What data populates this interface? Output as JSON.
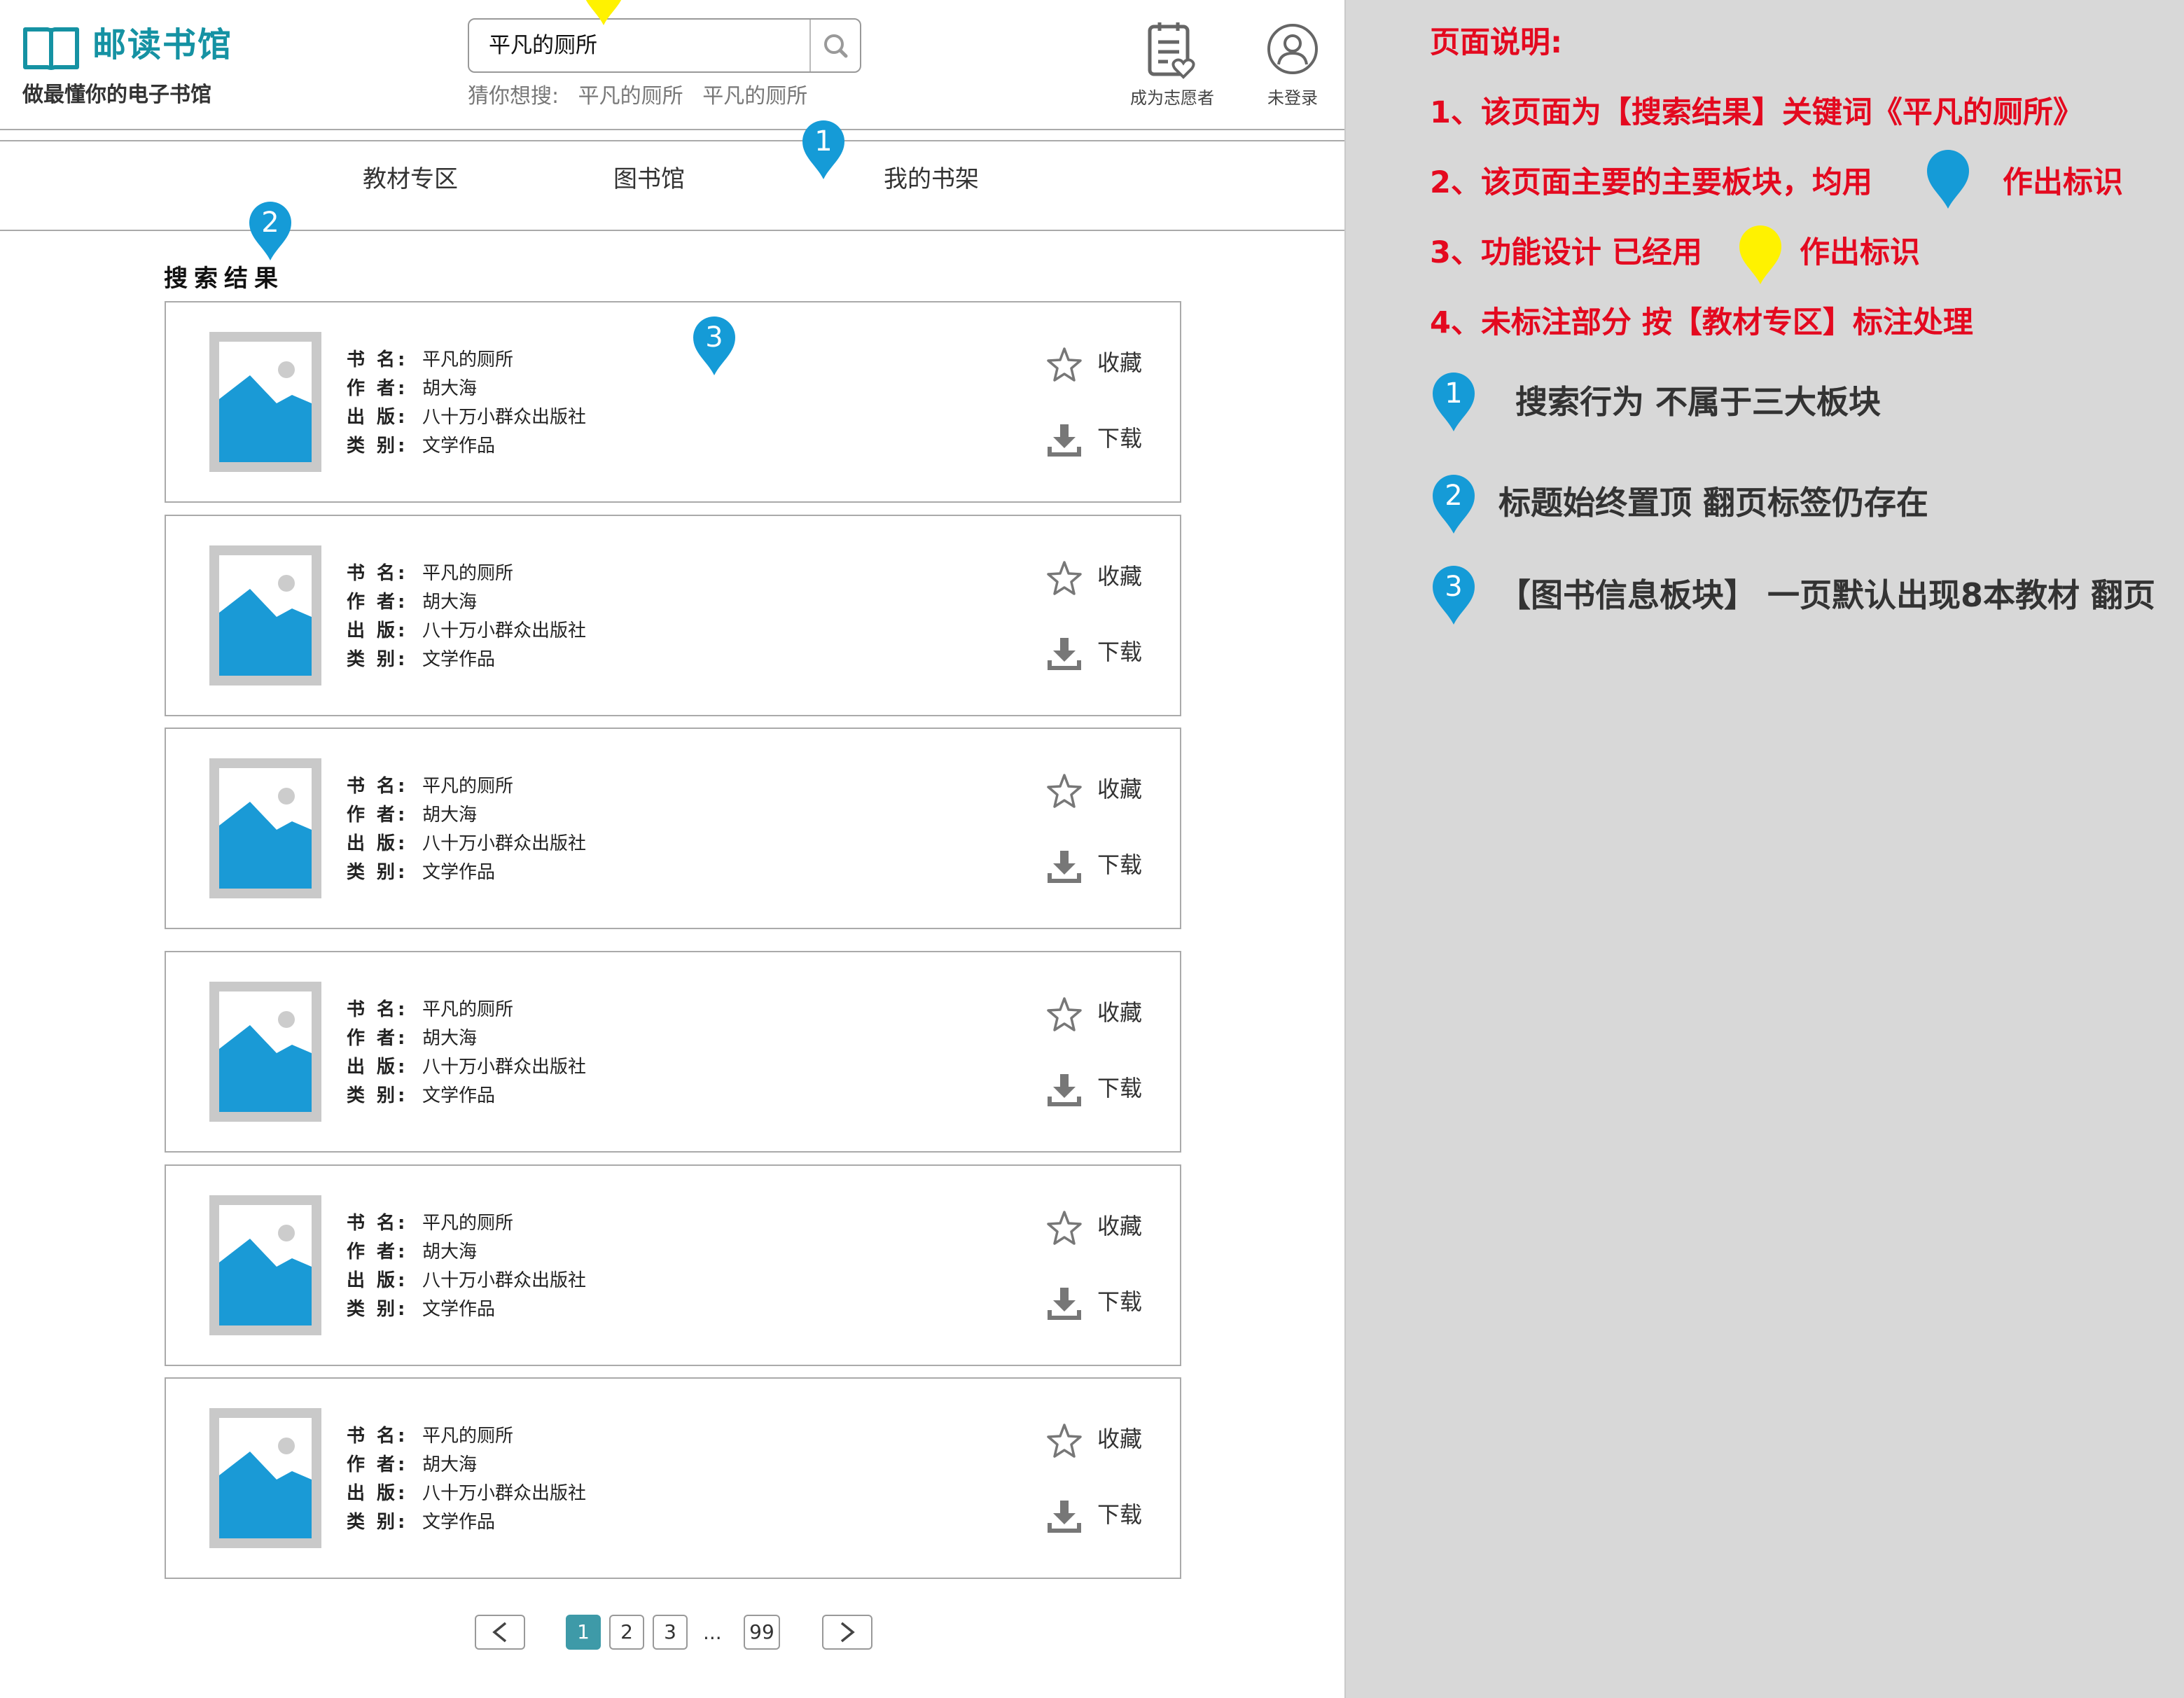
{
  "header": {
    "logo_text": "邮读书馆",
    "slogan": "做最懂你的电子书馆",
    "search_value": "平凡的厕所",
    "guess_label": "猜你想搜:",
    "guess_items": [
      "平凡的厕所",
      "平凡的厕所"
    ],
    "volunteer_label": "成为志愿者",
    "login_label": "未登录"
  },
  "nav": {
    "items": [
      {
        "label": "教材专区"
      },
      {
        "label": "图书馆"
      },
      {
        "label": "我的书架"
      }
    ]
  },
  "main": {
    "title": "搜索结果",
    "books": [
      {
        "name_key": "书 名:",
        "name": "平凡的厕所",
        "author_key": "作 者:",
        "author": "胡大海",
        "publisher_key": "出 版:",
        "publisher": "八十万小群众出版社",
        "category_key": "类 别:",
        "category": "文学作品",
        "fav_label": "收藏",
        "download_label": "下载"
      },
      {
        "name_key": "书 名:",
        "name": "平凡的厕所",
        "author_key": "作 者:",
        "author": "胡大海",
        "publisher_key": "出 版:",
        "publisher": "八十万小群众出版社",
        "category_key": "类 别:",
        "category": "文学作品",
        "fav_label": "收藏",
        "download_label": "下载"
      },
      {
        "name_key": "书 名:",
        "name": "平凡的厕所",
        "author_key": "作 者:",
        "author": "胡大海",
        "publisher_key": "出 版:",
        "publisher": "八十万小群众出版社",
        "category_key": "类 别:",
        "category": "文学作品",
        "fav_label": "收藏",
        "download_label": "下载"
      },
      {
        "name_key": "书 名:",
        "name": "平凡的厕所",
        "author_key": "作 者:",
        "author": "胡大海",
        "publisher_key": "出 版:",
        "publisher": "八十万小群众出版社",
        "category_key": "类 别:",
        "category": "文学作品",
        "fav_label": "收藏",
        "download_label": "下载"
      },
      {
        "name_key": "书 名:",
        "name": "平凡的厕所",
        "author_key": "作 者:",
        "author": "胡大海",
        "publisher_key": "出 版:",
        "publisher": "八十万小群众出版社",
        "category_key": "类 别:",
        "category": "文学作品",
        "fav_label": "收藏",
        "download_label": "下载"
      },
      {
        "name_key": "书 名:",
        "name": "平凡的厕所",
        "author_key": "作 者:",
        "author": "胡大海",
        "publisher_key": "出 版:",
        "publisher": "八十万小群众出版社",
        "category_key": "类 别:",
        "category": "文学作品",
        "fav_label": "收藏",
        "download_label": "下载"
      }
    ]
  },
  "pagination": {
    "prev_icon": "chevron-left-icon",
    "next_icon": "chevron-right-icon",
    "pages": [
      "1",
      "2",
      "3",
      "...",
      "99"
    ],
    "current": "1"
  },
  "markers": {
    "blue": [
      "1",
      "2",
      "3"
    ],
    "yellow": [
      "1"
    ]
  },
  "notes": {
    "heading": "页面说明:",
    "line1": "1、该页面为【搜索结果】关键词《平凡的厕所》",
    "line2_a": "2、该页面主要的主要板块，均用",
    "line2_b": "作出标识",
    "line3_a": "3、功能设计 已经用",
    "line3_b": "作出标识",
    "line4": "4、未标注部分 按【教材专区】标注处理",
    "legend": [
      {
        "num": "1",
        "text": "搜索行为 不属于三大板块"
      },
      {
        "num": "2",
        "text": "标题始终置顶 翻页标签仍存在"
      },
      {
        "num": "3",
        "text": "【图书信息板块】 一页默认出现8本教材 翻页"
      }
    ]
  },
  "colors": {
    "brand": "#1592a3",
    "pin_blue": "#159bd7",
    "pin_yellow": "#fff200",
    "note_red": "#e4091f",
    "page_active": "#3e9aa8",
    "thumb_blue": "#1a9ad6"
  }
}
